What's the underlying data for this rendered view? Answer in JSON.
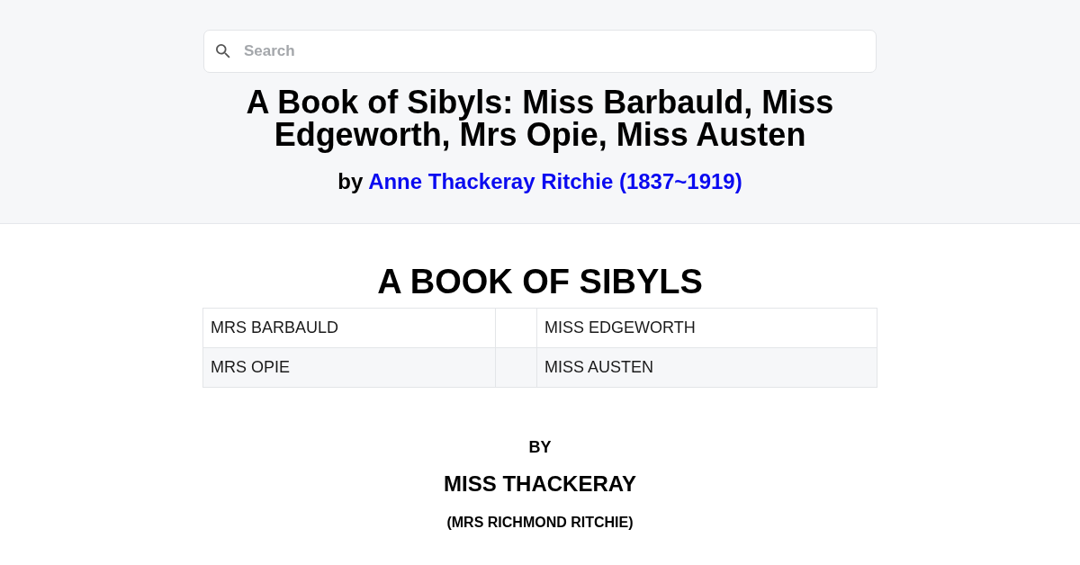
{
  "search": {
    "placeholder": "Search"
  },
  "book": {
    "title": "A Book of Sibyls: Miss Barbauld, Miss Edgeworth, Mrs Opie, Miss Austen",
    "byline": "by",
    "author_link": "Anne Thackeray Ritchie (1837~1919)"
  },
  "content": {
    "heading": "A BOOK OF SIBYLS",
    "table": {
      "rows": [
        {
          "column_1": "MRS BARBAULD",
          "column_3": "MISS EDGEWORTH"
        },
        {
          "column_1": "MRS OPIE",
          "column_3": "MISS AUSTEN"
        }
      ]
    },
    "by": "BY",
    "author": "MISS THACKERAY",
    "author_note": "(MRS RICHMOND RITCHIE)"
  }
}
